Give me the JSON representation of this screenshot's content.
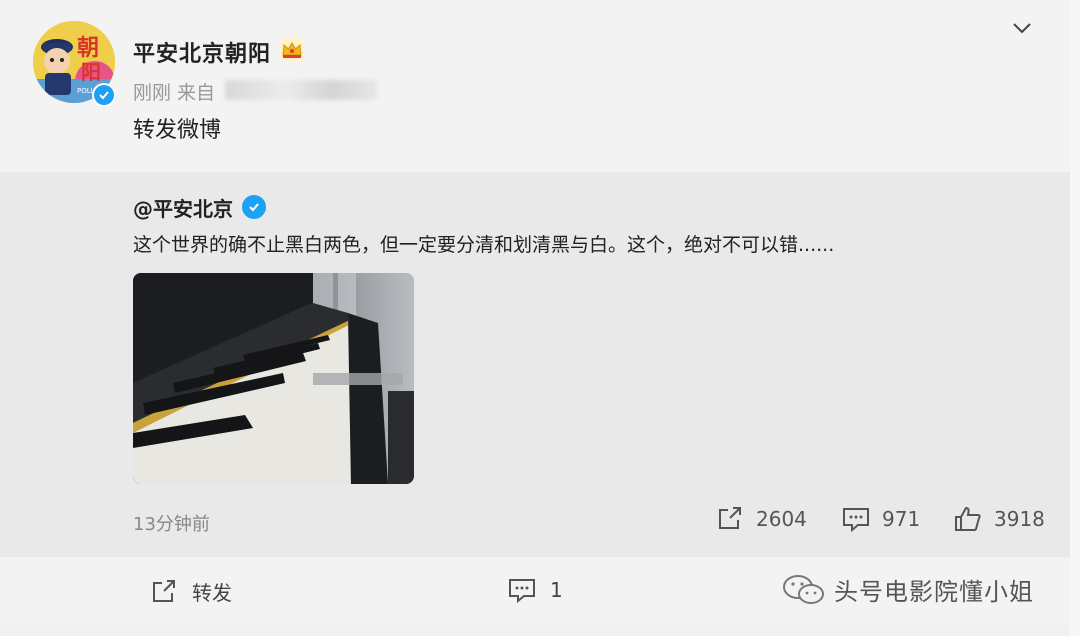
{
  "post": {
    "author": "平安北京朝阳",
    "meta_prefix": "刚刚 来自",
    "body": "转发微博",
    "avatar_text": [
      "朝",
      "阳"
    ],
    "avatar_badge": "POLICE"
  },
  "repost": {
    "author": "@平安北京",
    "text": "这个世界的确不止黑白两色，但一定要分清和划清黑与白。这个，绝对不可以错......",
    "time": "13分钟前",
    "stats": {
      "reposts": "2604",
      "comments": "971",
      "likes": "3918"
    }
  },
  "actions": {
    "repost_label": "转发",
    "comment_count": "1"
  },
  "watermark": "头号电影院懂小姐",
  "colors": {
    "verified_blue": "#1da1f2",
    "crown_gold": "#f5b71a",
    "background": "#f0f0f0",
    "repost_bg": "#e9e9e9"
  }
}
